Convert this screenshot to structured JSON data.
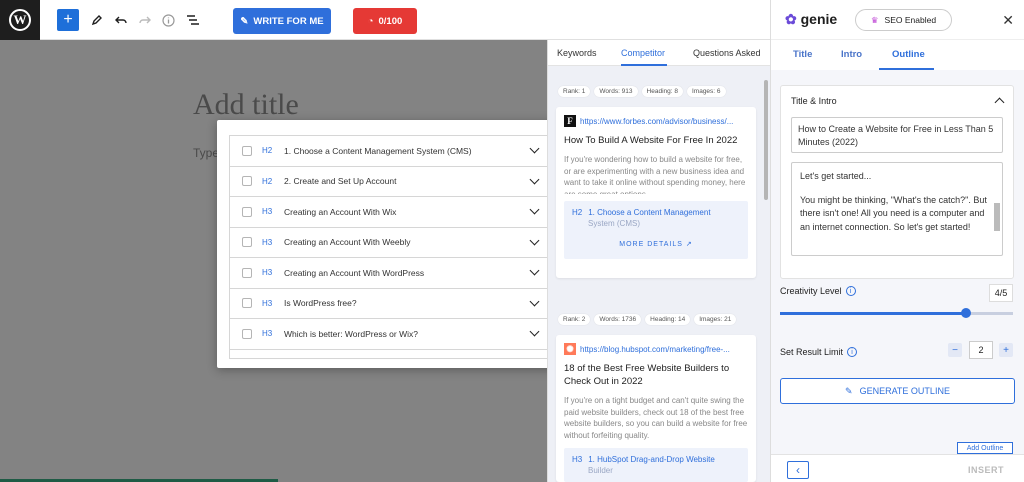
{
  "toolbar": {
    "write_label": "WRITE FOR ME",
    "score_label": "0/100"
  },
  "editor": {
    "title_placeholder": "Add title",
    "body_placeholder": "Type"
  },
  "modal": {
    "rows": [
      {
        "tag": "H2",
        "text": "1. Choose a Content Management System (CMS)"
      },
      {
        "tag": "H2",
        "text": "2. Create and Set Up Account"
      },
      {
        "tag": "H3",
        "text": "Creating an Account With Wix"
      },
      {
        "tag": "H3",
        "text": "Creating an Account With Weebly"
      },
      {
        "tag": "H3",
        "text": "Creating an Account With WordPress"
      },
      {
        "tag": "H3",
        "text": "Is WordPress free?"
      },
      {
        "tag": "H3",
        "text": "Which is better: WordPress or Wix?"
      }
    ]
  },
  "competitor": {
    "tabs": [
      "Keywords",
      "Competitor",
      "Questions Asked"
    ],
    "cards": [
      {
        "rank": "Rank: 1",
        "words": "Words: 913",
        "heading": "Heading: 8",
        "images": "Images: 6",
        "url": "https://www.forbes.com/advisor/business/...",
        "title": "How To Build A Website For Free In 2022",
        "desc": "If you're wondering how to build a website for free, or are experimenting with a new business idea and want to take it online without spending money, here are some great options...",
        "heading_tag": "H2",
        "heading_text": "1. Choose a Content Management",
        "heading_sub": "System (CMS)",
        "more": "MORE DETAILS"
      },
      {
        "rank": "Rank: 2",
        "words": "Words: 1736",
        "heading": "Heading: 14",
        "images": "Images: 21",
        "url": "https://blog.hubspot.com/marketing/free-...",
        "title": "18 of the Best Free Website Builders to Check Out in 2022",
        "desc": "If you're on a tight budget and can't quite swing the paid website builders, check out 18 of the best free website builders, so you can build a website for free without forfeiting quality.",
        "heading_tag": "H3",
        "heading_text": "1. HubSpot Drag-and-Drop Website",
        "heading_sub": "Builder"
      }
    ]
  },
  "genie": {
    "brand": "genie",
    "seo_label": "SEO Enabled",
    "tabs": [
      "Title",
      "Intro",
      "Outline"
    ],
    "section_title": "Title & Intro",
    "title_value": "How to Create a Website for Free in Less Than 5 Minutes (2022)",
    "intro_line1": "Let's get started...",
    "intro_line2": "You might be thinking, \"What's the catch?\". But there isn't one! All you need is a computer and an internet connection. So let's get started!",
    "creativity_label": "Creativity Level",
    "creativity_value": "4/5",
    "creativity_fraction": 0.8,
    "limit_label": "Set Result Limit",
    "limit_value": "2",
    "generate_label": "GENERATE OUTLINE",
    "add_outline_label": "Add Outline",
    "insert_label": "INSERT"
  },
  "colors": {
    "accent": "#2f6fdb",
    "score_red": "#e53935",
    "wp_dark": "#1e1e1e"
  }
}
